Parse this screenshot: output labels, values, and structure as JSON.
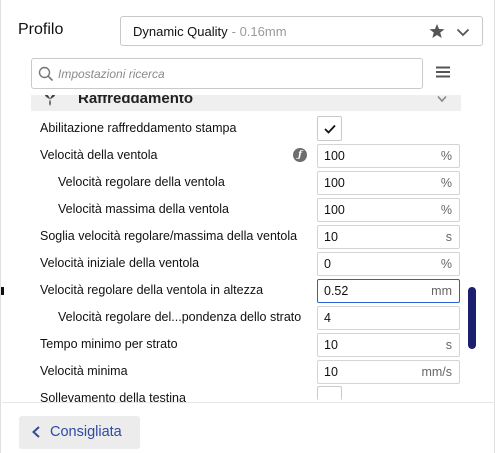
{
  "profile": {
    "label": "Profilo",
    "selected_name": "Dynamic Quality",
    "selected_detail": "- 0.16mm"
  },
  "search": {
    "placeholder": "Impostazioni ricerca"
  },
  "category": {
    "label": "Raffreddamento"
  },
  "settings": [
    {
      "label": "Abilitazione raffreddamento stampa",
      "type": "checkbox",
      "checked": true
    },
    {
      "label": "Velocità della ventola",
      "value": "100",
      "unit": "%"
    },
    {
      "label": "Velocità regolare della ventola",
      "value": "100",
      "unit": "%"
    },
    {
      "label": "Velocità massima della ventola",
      "value": "100",
      "unit": "%"
    },
    {
      "label": "Soglia velocità regolare/massima della ventola",
      "value": "10",
      "unit": "s"
    },
    {
      "label": "Velocità iniziale della ventola",
      "value": "0",
      "unit": "%"
    },
    {
      "label": "Velocità regolare della ventola in altezza",
      "value": "0.52",
      "unit": "mm"
    },
    {
      "label": "Velocità regolare del...pondenza dello strato",
      "value": "4",
      "unit": ""
    },
    {
      "label": "Tempo minimo per strato",
      "value": "10",
      "unit": "s"
    },
    {
      "label": "Velocità minima",
      "value": "10",
      "unit": "mm/s"
    },
    {
      "label": "Sollevamento della testina",
      "type": "checkbox",
      "checked": false
    }
  ],
  "footer": {
    "recommended_label": "Consigliata"
  },
  "colors": {
    "accent": "#2b5fd9",
    "scrollbar": "#1c1f70",
    "link": "#2f4aa0"
  },
  "icons": {
    "star": "star-icon",
    "chevron": "chevron-down-icon",
    "search": "search-icon",
    "menu": "hamburger-menu-icon",
    "category": "fan-icon",
    "function": "function-icon",
    "back": "chevron-left-icon"
  }
}
